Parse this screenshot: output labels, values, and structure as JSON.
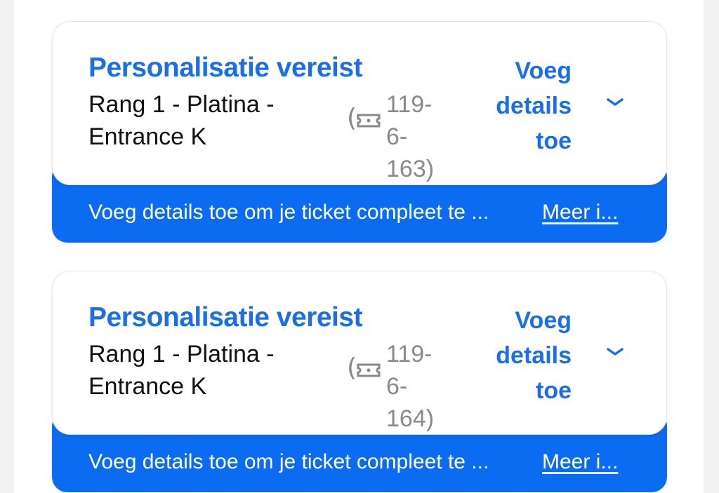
{
  "colors": {
    "accent": "#1a6fe8",
    "banner": "#0b6cf2",
    "text": "#111111",
    "muted": "#8a8a8a"
  },
  "tickets": [
    {
      "status": "Personalisatie vereist",
      "seat_line1": "Rang 1 - Platina -",
      "seat_line2": "Entrance K",
      "paren_open": "(",
      "ticket_icon": "ticket-icon",
      "seat_number_line1": "119-6-",
      "seat_number_line2": "163)",
      "action_line1": "Voeg",
      "action_line2": "details",
      "action_line3": "toe",
      "expand_icon": "chevron-down-icon",
      "banner_text": "Voeg details toe om je ticket compleet te ...",
      "banner_link": "Meer i..."
    },
    {
      "status": "Personalisatie vereist",
      "seat_line1": "Rang 1 - Platina -",
      "seat_line2": "Entrance K",
      "paren_open": "(",
      "ticket_icon": "ticket-icon",
      "seat_number_line1": "119-6-",
      "seat_number_line2": "164)",
      "action_line1": "Voeg",
      "action_line2": "details",
      "action_line3": "toe",
      "expand_icon": "chevron-down-icon",
      "banner_text": "Voeg details toe om je ticket compleet te ...",
      "banner_link": "Meer i..."
    }
  ]
}
